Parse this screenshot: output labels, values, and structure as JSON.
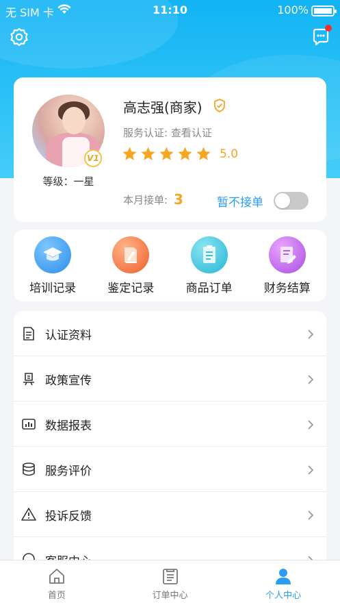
{
  "status_bar": {
    "carrier": "无 SIM 卡",
    "time": "11:10",
    "battery": "100%"
  },
  "header": {
    "settings_icon": "gear-icon",
    "message_icon": "chat-bubble-icon",
    "has_unread": true
  },
  "profile": {
    "name": "高志强(商家)",
    "certification": "服务认证: 查看认证",
    "rating": "5.0",
    "stars": 5,
    "level": "等级：一星",
    "avatar_badge": "V1",
    "month_orders_label": "本月接单:",
    "month_orders_count": "3",
    "pause_label": "暂不接单",
    "accepting_toggle_on": false
  },
  "quick_actions": [
    {
      "label": "培训记录",
      "icon": "graduation-cap-icon",
      "color": "#3a9cf2"
    },
    {
      "label": "鉴定记录",
      "icon": "certificate-pen-icon",
      "color": "#f2743a"
    },
    {
      "label": "商品订单",
      "icon": "clipboard-icon",
      "color": "#37c1dc"
    },
    {
      "label": "财务结算",
      "icon": "note-pen-icon",
      "color": "#c062e8"
    }
  ],
  "menu": [
    {
      "label": "认证资料",
      "icon": "document-icon"
    },
    {
      "label": "政策宣传",
      "icon": "presentation-icon"
    },
    {
      "label": "数据报表",
      "icon": "bar-chart-icon"
    },
    {
      "label": "服务评价",
      "icon": "database-icon"
    },
    {
      "label": "投诉反馈",
      "icon": "warning-icon"
    },
    {
      "label": "客服中心",
      "icon": "headset-icon"
    }
  ],
  "tabbar": [
    {
      "label": "首页",
      "icon": "home-icon",
      "active": false
    },
    {
      "label": "订单中心",
      "icon": "order-list-icon",
      "active": false
    },
    {
      "label": "个人中心",
      "icon": "person-icon",
      "active": true
    }
  ],
  "colors": {
    "primary": "#2a9df4",
    "header_gradient": "#12b3f4",
    "accent": "#f5a623"
  }
}
